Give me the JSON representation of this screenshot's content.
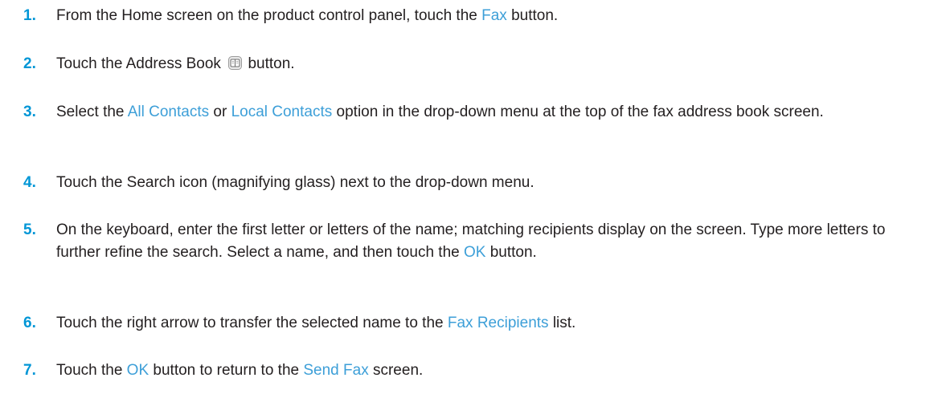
{
  "steps": [
    {
      "number": "1.",
      "parts": [
        {
          "text": "From the Home screen on the product control panel, touch the ",
          "hl": false
        },
        {
          "text": "Fax",
          "hl": true
        },
        {
          "text": " button.",
          "hl": false
        }
      ]
    },
    {
      "number": "2.",
      "parts": [
        {
          "text": "Touch the Address Book ",
          "hl": false
        },
        {
          "icon": "address-book-icon"
        },
        {
          "text": " button.",
          "hl": false
        }
      ]
    },
    {
      "number": "3.",
      "parts": [
        {
          "text": "Select the ",
          "hl": false
        },
        {
          "text": "All Contacts",
          "hl": true
        },
        {
          "text": " or ",
          "hl": false
        },
        {
          "text": "Local Contacts",
          "hl": true
        },
        {
          "text": " option in the drop-down menu at the top of the fax address book screen.",
          "hl": false
        }
      ]
    },
    {
      "number": "4.",
      "parts": [
        {
          "text": "Touch the Search icon (magnifying glass) next to the drop-down menu.",
          "hl": false
        }
      ]
    },
    {
      "number": "5.",
      "parts": [
        {
          "text": "On the keyboard, enter the first letter or letters of the name; matching recipients display on the screen. Type more letters to further refine the search. Select a name, and then touch the ",
          "hl": false
        },
        {
          "text": "OK",
          "hl": true
        },
        {
          "text": " button.",
          "hl": false
        }
      ]
    },
    {
      "number": "6.",
      "parts": [
        {
          "text": "Touch the right arrow to transfer the selected name to the ",
          "hl": false
        },
        {
          "text": "Fax Recipients",
          "hl": true
        },
        {
          "text": " list.",
          "hl": false
        }
      ]
    },
    {
      "number": "7.",
      "parts": [
        {
          "text": "Touch the ",
          "hl": false
        },
        {
          "text": "OK",
          "hl": true
        },
        {
          "text": " button to return to the ",
          "hl": false
        },
        {
          "text": "Send Fax",
          "hl": true
        },
        {
          "text": " screen.",
          "hl": false
        }
      ]
    }
  ],
  "colors": {
    "number": "#0096d6",
    "highlight": "#3d9fd8",
    "text": "#231f20"
  }
}
